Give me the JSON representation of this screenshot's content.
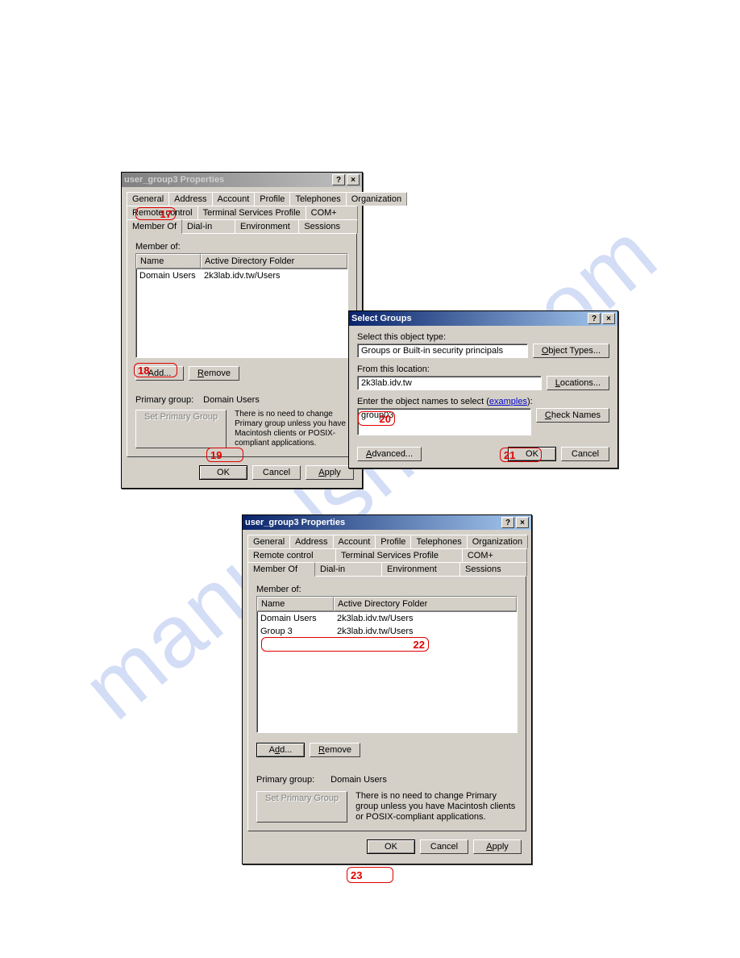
{
  "upper_props": {
    "title": "user_group3 Properties",
    "tabs_row1": [
      "General",
      "Address",
      "Account",
      "Profile",
      "Telephones",
      "Organization"
    ],
    "tabs_row2": [
      "Remote control",
      "Terminal Services Profile",
      "COM+"
    ],
    "tabs_row3": [
      "Member Of",
      "Dial-in",
      "Environment",
      "Sessions"
    ],
    "memberof_label": "Member of:",
    "col_name": "Name",
    "col_folder": "Active Directory Folder",
    "rows": [
      {
        "name": "Domain Users",
        "folder": "2k3lab.idv.tw/Users"
      }
    ],
    "add_btn": "Add...",
    "remove_btn": "Remove",
    "primary_label": "Primary group:",
    "primary_value": "Domain Users",
    "set_primary_btn": "Set Primary Group",
    "primary_note": "There is no need to change Primary group unless you have Macintosh clients or POSIX-compliant applications.",
    "ok": "OK",
    "cancel": "Cancel",
    "apply": "Apply"
  },
  "select_groups": {
    "title": "Select Groups",
    "select_type_label": "Select this object type:",
    "object_type": "Groups or Built-in security principals",
    "object_types_btn": "Object Types...",
    "from_loc_label": "From this location:",
    "location": "2k3lab.idv.tw",
    "locations_btn": "Locations...",
    "enter_names_label_pre": "Enter the object names to select (",
    "enter_names_link": "examples",
    "enter_names_label_post": "):",
    "names_value": "group03",
    "check_names_btn": "Check Names",
    "advanced_btn": "Advanced...",
    "ok": "OK",
    "cancel": "Cancel"
  },
  "lower_props": {
    "title": "user_group3 Properties",
    "tabs_row1": [
      "General",
      "Address",
      "Account",
      "Profile",
      "Telephones",
      "Organization"
    ],
    "tabs_row2": [
      "Remote control",
      "Terminal Services Profile",
      "COM+"
    ],
    "tabs_row3": [
      "Member Of",
      "Dial-in",
      "Environment",
      "Sessions"
    ],
    "memberof_label": "Member of:",
    "col_name": "Name",
    "col_folder": "Active Directory Folder",
    "rows": [
      {
        "name": "Domain Users",
        "folder": "2k3lab.idv.tw/Users"
      },
      {
        "name": "Group 3",
        "folder": "2k3lab.idv.tw/Users"
      }
    ],
    "add_btn": "Add...",
    "remove_btn": "Remove",
    "primary_label": "Primary group:",
    "primary_value": "Domain Users",
    "set_primary_btn": "Set Primary Group",
    "primary_note": "There is no need to change Primary group unless you have Macintosh clients or POSIX-compliant applications.",
    "ok": "OK",
    "cancel": "Cancel",
    "apply": "Apply"
  },
  "callouts": {
    "c17": "17",
    "c18": "18",
    "c19": "19",
    "c20": "20",
    "c21": "21",
    "c22": "22",
    "c23": "23"
  }
}
